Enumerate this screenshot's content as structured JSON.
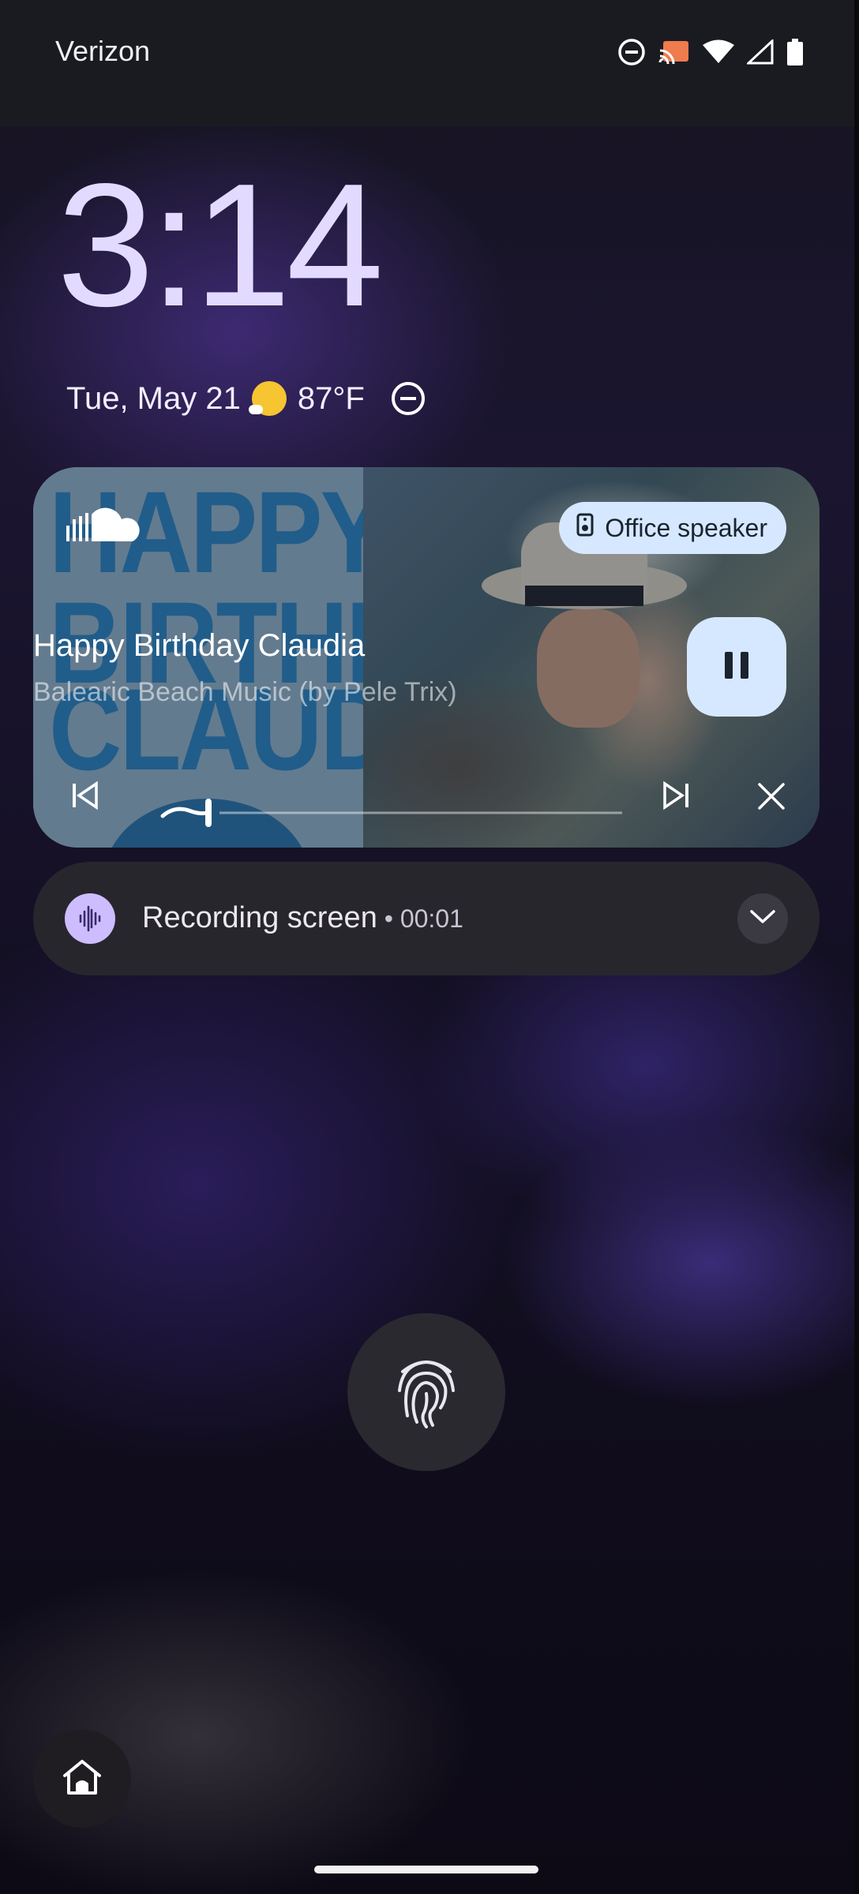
{
  "status_bar": {
    "carrier": "Verizon",
    "icons": [
      "do-not-disturb-icon",
      "cast-icon",
      "wifi-icon",
      "signal-icon",
      "battery-icon"
    ]
  },
  "lockscreen": {
    "time": "3:14",
    "date": "Tue, May 21",
    "weather_icon": "sun-icon",
    "temperature": "87°F",
    "dnd_icon": "do-not-disturb-icon"
  },
  "media_player": {
    "app_icon": "soundcloud-icon",
    "artwork_text": [
      "HAPPY",
      "BIRTHDAY",
      "CLAUDIA"
    ],
    "output_device": "Office speaker",
    "title": "Happy Birthday Claudia",
    "artist": "Balearic Beach Music (by Pele Trix)",
    "playing": true,
    "progress": 0.06,
    "controls": {
      "previous": "skip-previous-icon",
      "pause": "pause-icon",
      "next": "skip-next-icon",
      "close": "close-icon"
    }
  },
  "notification": {
    "icon": "sound-waves-icon",
    "title": "Recording screen",
    "separator": " • ",
    "elapsed": "00:01",
    "expand_icon": "chevron-down-icon"
  },
  "fingerprint": {
    "icon": "fingerprint-icon"
  },
  "shortcut": {
    "icon": "home-icon"
  },
  "colors": {
    "accent_light": "#d6e8ff",
    "clock": "#e3dbff",
    "recording_icon_bg": "#cdbdff",
    "notification_bg": "#28262d"
  }
}
